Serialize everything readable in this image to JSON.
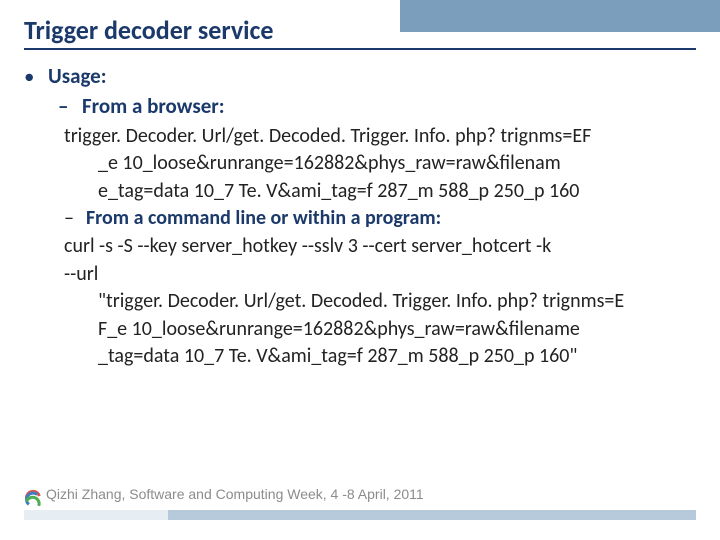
{
  "title": "Trigger decoder service",
  "bullets": {
    "usage": "Usage:",
    "from_browser": "From a browser:"
  },
  "lines": {
    "l1": "trigger. Decoder. Url/get. Decoded. Trigger. Info. php? trignms=EF",
    "l2": "_e 10_loose&runrange=162882&phys_raw=raw&filenam",
    "l3": "e_tag=data 10_7 Te. V&ami_tag=f 287_m 588_p 250_p 160",
    "cmdline_label": "From a command line or within a program:",
    "l4": "curl -s -S --key server_hotkey --sslv 3 --cert server_hotcert -k",
    "l5": "--url",
    "l6": "\"trigger. Decoder. Url/get. Decoded. Trigger. Info. php? trignms=E",
    "l7": "F_e 10_loose&runrange=162882&phys_raw=raw&filename",
    "l8": "_tag=data 10_7 Te. V&ami_tag=f 287_m 588_p 250_p 160\""
  },
  "footer": "Qizhi Zhang, Software and Computing Week, 4 -8 April, 2011"
}
